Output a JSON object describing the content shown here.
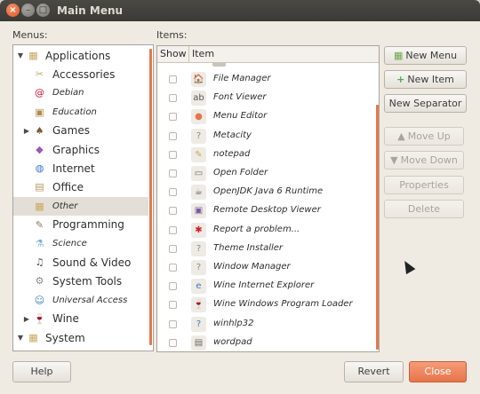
{
  "window": {
    "title": "Main Menu"
  },
  "labels": {
    "menus": "Menus:",
    "items": "Items:"
  },
  "columns": {
    "show": "Show",
    "item": "Item"
  },
  "menus": [
    {
      "label": "Applications",
      "style": "big",
      "expander": "open",
      "depth": 0,
      "icon": "applications-icon",
      "glyph": "▦",
      "color": "#c8a85a"
    },
    {
      "label": "Accessories",
      "style": "big",
      "expander": "",
      "depth": 1,
      "icon": "accessories-icon",
      "glyph": "✂",
      "color": "#c8a85a"
    },
    {
      "label": "Debian",
      "style": "small",
      "expander": "",
      "depth": 1,
      "icon": "debian-icon",
      "glyph": "@",
      "color": "#c8102e"
    },
    {
      "label": "Education",
      "style": "small",
      "expander": "",
      "depth": 1,
      "icon": "education-icon",
      "glyph": "▣",
      "color": "#b08a4a"
    },
    {
      "label": "Games",
      "style": "big",
      "expander": "closed",
      "depth": 1,
      "icon": "games-icon",
      "glyph": "♠",
      "color": "#7a5a3a"
    },
    {
      "label": "Graphics",
      "style": "big",
      "expander": "",
      "depth": 1,
      "icon": "graphics-icon",
      "glyph": "◆",
      "color": "#9b59b6"
    },
    {
      "label": "Internet",
      "style": "big",
      "expander": "",
      "depth": 1,
      "icon": "internet-icon",
      "glyph": "◍",
      "color": "#3a78c4"
    },
    {
      "label": "Office",
      "style": "big",
      "expander": "",
      "depth": 1,
      "icon": "office-icon",
      "glyph": "▤",
      "color": "#b89860"
    },
    {
      "label": "Other",
      "style": "small",
      "expander": "",
      "depth": 1,
      "icon": "other-icon",
      "glyph": "▦",
      "color": "#c8a85a",
      "selected": true
    },
    {
      "label": "Programming",
      "style": "big",
      "expander": "",
      "depth": 1,
      "icon": "programming-icon",
      "glyph": "✎",
      "color": "#8a7a5a"
    },
    {
      "label": "Science",
      "style": "small",
      "expander": "",
      "depth": 1,
      "icon": "science-icon",
      "glyph": "⚗",
      "color": "#7fb0d0"
    },
    {
      "label": "Sound & Video",
      "style": "big",
      "expander": "",
      "depth": 1,
      "icon": "sound-video-icon",
      "glyph": "♫",
      "color": "#4a4a4a"
    },
    {
      "label": "System Tools",
      "style": "big",
      "expander": "",
      "depth": 1,
      "icon": "system-tools-icon",
      "glyph": "⚙",
      "color": "#8a8a8a"
    },
    {
      "label": "Universal Access",
      "style": "small",
      "expander": "",
      "depth": 1,
      "icon": "universal-access-icon",
      "glyph": "☺",
      "color": "#3a78c4"
    },
    {
      "label": "Wine",
      "style": "big",
      "expander": "closed",
      "depth": 1,
      "icon": "wine-icon",
      "glyph": "🍷",
      "color": "#a02030"
    },
    {
      "label": "System",
      "style": "big",
      "expander": "open",
      "depth": 0,
      "icon": "system-icon",
      "glyph": "▦",
      "color": "#c8a85a"
    }
  ],
  "items": [
    {
      "label": "File Manager",
      "icon": "file-manager-icon",
      "glyph": "🏠",
      "color": "#e8744a"
    },
    {
      "label": "Font Viewer",
      "icon": "font-viewer-icon",
      "glyph": "ab",
      "color": "#555555"
    },
    {
      "label": "Menu Editor",
      "icon": "menu-editor-icon",
      "glyph": "●",
      "color": "#e8744a"
    },
    {
      "label": "Metacity",
      "icon": "metacity-icon",
      "glyph": "?",
      "color": "#8a8a8a"
    },
    {
      "label": "notepad",
      "icon": "notepad-icon",
      "glyph": "✎",
      "color": "#c8a85a"
    },
    {
      "label": "Open Folder",
      "icon": "open-folder-icon",
      "glyph": "▭",
      "color": "#6a6a6a"
    },
    {
      "label": "OpenJDK Java 6 Runtime",
      "icon": "java-icon",
      "glyph": "☕",
      "color": "#555555"
    },
    {
      "label": "Remote Desktop Viewer",
      "icon": "remote-desktop-icon",
      "glyph": "▣",
      "color": "#7a5aa0"
    },
    {
      "label": "Report a problem...",
      "icon": "report-problem-icon",
      "glyph": "✱",
      "color": "#d02020"
    },
    {
      "label": "Theme Installer",
      "icon": "theme-installer-icon",
      "glyph": "?",
      "color": "#8a8a8a"
    },
    {
      "label": "Window Manager",
      "icon": "window-manager-icon",
      "glyph": "?",
      "color": "#8a8a8a"
    },
    {
      "label": "Wine Internet Explorer",
      "icon": "internet-explorer-icon",
      "glyph": "e",
      "color": "#3a78c4"
    },
    {
      "label": "Wine Windows Program Loader",
      "icon": "wine-loader-icon",
      "glyph": "🍷",
      "color": "#a02030"
    },
    {
      "label": "winhlp32",
      "icon": "winhlp32-icon",
      "glyph": "?",
      "color": "#3a78c4"
    },
    {
      "label": "wordpad",
      "icon": "wordpad-icon",
      "glyph": "▤",
      "color": "#6a6a6a"
    }
  ],
  "buttons": {
    "new_menu": "New Menu",
    "new_item": "New Item",
    "new_separator": "New Separator",
    "move_up": "Move Up",
    "move_down": "Move Down",
    "properties": "Properties",
    "delete": "Delete",
    "help": "Help",
    "revert": "Revert",
    "close": "Close"
  },
  "colors": {
    "accent": "#e8744a",
    "titlebar": "#3b3a36",
    "window_bg": "#f0ebe2"
  }
}
